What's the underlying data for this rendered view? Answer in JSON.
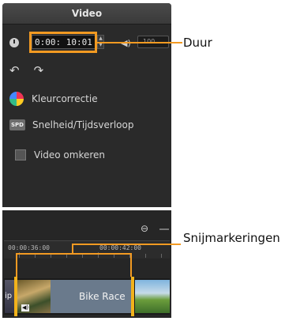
{
  "panel": {
    "title": "Video",
    "timecode": "0:00: 10:01",
    "volume": "100",
    "items": [
      {
        "label": "Kleurcorrectie"
      },
      {
        "label": "Snelheid/Tijdsverloop"
      },
      {
        "label": "Video omkeren"
      }
    ]
  },
  "timeline": {
    "tick1": "00:00:36:00",
    "tick2": "00:00:42:00",
    "clip_title": "Bike Race",
    "clip_left_text": "ip"
  },
  "callouts": {
    "duration": "Duur",
    "trim_markers": "Snijmarkeringen"
  },
  "colors": {
    "accent": "#f29a22",
    "panel_bg": "#2a2a2a",
    "marker": "#f2b21b"
  }
}
